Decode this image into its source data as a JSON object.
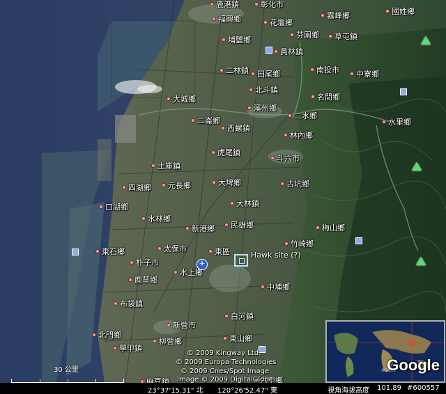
{
  "places": [
    {
      "name": "鹿港鎮",
      "id": "lugang"
    },
    {
      "name": "彰化市",
      "id": "changhua"
    },
    {
      "name": "霧峰鄉",
      "id": "wufeng"
    },
    {
      "name": "國姓鄉",
      "id": "guoxing"
    },
    {
      "name": "福興鄉",
      "id": "fuxing"
    },
    {
      "name": "花壇鄉",
      "id": "huatan"
    },
    {
      "name": "芬園鄉",
      "id": "fenyuan"
    },
    {
      "name": "草屯鎮",
      "id": "caotun"
    },
    {
      "name": "埔鹽鄉",
      "id": "puyan"
    },
    {
      "name": "員林鎮",
      "id": "yuanlin"
    },
    {
      "name": "二林鎮",
      "id": "erlin"
    },
    {
      "name": "田尾鄉",
      "id": "tianwei"
    },
    {
      "name": "南投市",
      "id": "nantou"
    },
    {
      "name": "中寮鄉",
      "id": "zhongliao"
    },
    {
      "name": "北斗鎮",
      "id": "beidou"
    },
    {
      "name": "大城鄉",
      "id": "dacheng"
    },
    {
      "name": "名間鄉",
      "id": "mingjian"
    },
    {
      "name": "溪州鄉",
      "id": "xizhou"
    },
    {
      "name": "二水鄉",
      "id": "ershui"
    },
    {
      "name": "水里鄉",
      "id": "shuili"
    },
    {
      "name": "二崙鄉",
      "id": "erlun"
    },
    {
      "name": "西螺鎮",
      "id": "xiluo"
    },
    {
      "name": "林內鄉",
      "id": "linnei"
    },
    {
      "name": "虎尾鎮",
      "id": "huwei"
    },
    {
      "name": "斗六市",
      "id": "douliu"
    },
    {
      "name": "土庫鎮",
      "id": "tuku"
    },
    {
      "name": "四湖鄉",
      "id": "sihu"
    },
    {
      "name": "元長鄉",
      "id": "yuanchang"
    },
    {
      "name": "大埤鄉",
      "id": "dapi"
    },
    {
      "name": "古坑鄉",
      "id": "gukeng"
    },
    {
      "name": "口湖鄉",
      "id": "kouhu"
    },
    {
      "name": "大林鎮",
      "id": "dalin"
    },
    {
      "name": "水林鄉",
      "id": "shuilin"
    },
    {
      "name": "梅山鄉",
      "id": "meishan"
    },
    {
      "name": "新港鄉",
      "id": "xingang"
    },
    {
      "name": "民雄鄉",
      "id": "minxiong"
    },
    {
      "name": "竹崎鄉",
      "id": "zhuqi"
    },
    {
      "name": "東石鄉",
      "id": "dongshi"
    },
    {
      "name": "太保市",
      "id": "taibao"
    },
    {
      "name": "東區",
      "id": "dongqu"
    },
    {
      "name": "朴子市",
      "id": "puzi"
    },
    {
      "name": "水上鄉",
      "id": "shuishang"
    },
    {
      "name": "鹿草鄉",
      "id": "lucao"
    },
    {
      "name": "中埔鄉",
      "id": "zhongpu"
    },
    {
      "name": "布袋鎮",
      "id": "budai"
    },
    {
      "name": "白河鎮",
      "id": "baihe"
    },
    {
      "name": "新營市",
      "id": "xinying"
    },
    {
      "name": "北門鄉",
      "id": "beimen"
    },
    {
      "name": "東山鄉",
      "id": "dongshan"
    },
    {
      "name": "學甲鎮",
      "id": "xuejia"
    },
    {
      "name": "柳營鄉",
      "id": "liuying"
    },
    {
      "name": "麻豆鎮",
      "id": "madou"
    },
    {
      "name": "六甲鄉",
      "id": "liujia"
    }
  ],
  "hawk_site": "Hawk site (?)",
  "airport_icon": "airplane-icon",
  "copyright": [
    "© 2009 Kingway Ltd.",
    "© 2009 Europa Technologies",
    "© 2009 Cnes/Spot Image",
    "Image © 2009 DigitalGlobe"
  ],
  "scale_label": "30 公里",
  "minimap": {
    "logo": "Google",
    "small_text": "©2009"
  },
  "status": {
    "coords_lat": "23°37'15.31\" 北",
    "coords_lon": "120°26'52.47\" 東",
    "elev_label": "視角海拔高度",
    "elev_value": "101.89",
    "ref": "#600557"
  }
}
